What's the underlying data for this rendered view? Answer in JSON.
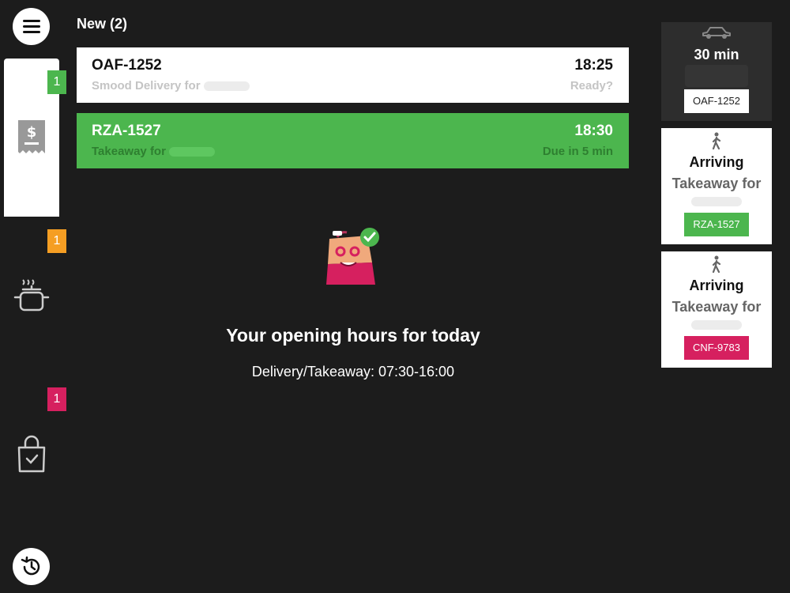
{
  "colors": {
    "background": "#1c1c1c",
    "ready_green": "#4cb64e",
    "warn_orange": "#f59e23",
    "alert_pink": "#d6205f"
  },
  "rail": {
    "menu_icon": "hamburger-icon",
    "tabs": [
      {
        "icon": "receipt-dollar-icon",
        "badge": "1",
        "badge_color": "#4cb64e",
        "active": true
      },
      {
        "icon": "cooking-pot-icon",
        "badge": "1",
        "badge_color": "#f59e23",
        "active": false
      },
      {
        "icon": "bag-check-icon",
        "badge": "1",
        "badge_color": "#d6205f",
        "active": false
      }
    ],
    "history_icon": "history-icon"
  },
  "main": {
    "section_title": "New (2)",
    "orders": [
      {
        "code": "OAF-1252",
        "time": "18:25",
        "subtitle": "Smood Delivery for",
        "status": "Ready?"
      },
      {
        "code": "RZA-1527",
        "time": "18:30",
        "subtitle": "Takeaway for",
        "status": "Due in 5 min"
      }
    ],
    "hours_title": "Your opening hours for today",
    "hours_line": "Delivery/Takeaway: 07:30-16:00"
  },
  "side": {
    "courier": {
      "icon": "car-icon",
      "eta": "30 min",
      "code": "OAF-1252"
    },
    "arrivals": [
      {
        "icon": "walking-person-icon",
        "status": "Arriving",
        "label": "Takeaway for",
        "code": "RZA-1527",
        "chip_color": "#4cb64e"
      },
      {
        "icon": "walking-person-icon",
        "status": "Arriving",
        "label": "Takeaway for",
        "code": "CNF-9783",
        "chip_color": "#d6205f"
      }
    ]
  }
}
